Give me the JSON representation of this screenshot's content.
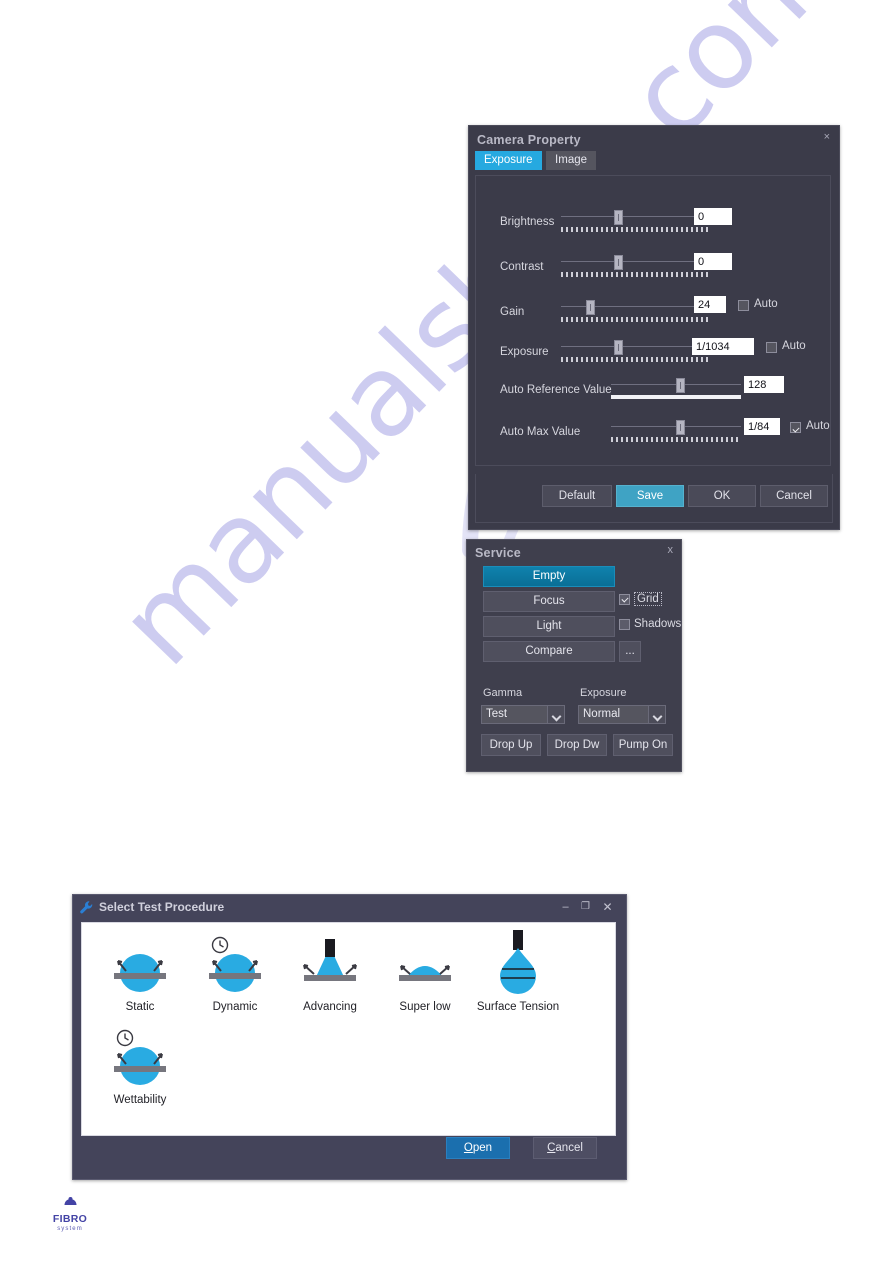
{
  "page": {
    "watermark": "manualshine.com"
  },
  "camera_property": {
    "title": "Camera Property",
    "close_label": "×",
    "tabs": [
      {
        "label": "Exposure",
        "active": true
      },
      {
        "label": "Image",
        "active": false
      }
    ],
    "rows": [
      {
        "label": "Brightness",
        "value": "0",
        "auto_label": null,
        "auto_checked": false,
        "thumb_pct": 36,
        "track_style": "dashed"
      },
      {
        "label": "Contrast",
        "value": "0",
        "auto_label": null,
        "auto_checked": false,
        "thumb_pct": 36,
        "track_style": "dashed"
      },
      {
        "label": "Gain",
        "value": "24",
        "auto_label": "Auto",
        "auto_checked": false,
        "thumb_pct": 17,
        "track_style": "dashed"
      },
      {
        "label": "Exposure",
        "value": "1/1034",
        "auto_label": "Auto",
        "auto_checked": false,
        "thumb_pct": 36,
        "track_style": "dashed"
      },
      {
        "label": "Auto Reference Value",
        "value": "128",
        "auto_label": null,
        "auto_checked": false,
        "thumb_pct": 50,
        "track_style": "solid"
      },
      {
        "label": "Auto Max Value",
        "value": "1/84",
        "auto_label": "Auto",
        "auto_checked": true,
        "thumb_pct": 50,
        "track_style": "dashed"
      }
    ],
    "buttons": [
      {
        "label": "Default",
        "accent": false
      },
      {
        "label": "Save",
        "accent": true
      },
      {
        "label": "OK",
        "accent": false
      },
      {
        "label": "Cancel",
        "accent": false
      }
    ]
  },
  "service": {
    "title": "Service",
    "close_label": "x",
    "buttons": [
      {
        "label": "Empty",
        "accent": true
      },
      {
        "label": "Focus",
        "accent": false
      },
      {
        "label": "Light",
        "accent": false
      },
      {
        "label": "Compare",
        "accent": false
      }
    ],
    "ellipsis_button": "...",
    "checkboxes": [
      {
        "label": "Grid",
        "checked": true,
        "focused": true
      },
      {
        "label": "Shadows",
        "checked": false,
        "focused": false
      }
    ],
    "selects": [
      {
        "group_label": "Gamma",
        "value": "Test"
      },
      {
        "group_label": "Exposure",
        "value": "Normal"
      }
    ],
    "action_buttons": [
      "Drop Up",
      "Drop Dw",
      "Pump On"
    ]
  },
  "select_test_procedure": {
    "title": "Select Test Procedure",
    "icon": "wrench-icon",
    "window_buttons": [
      {
        "name": "minimize",
        "glyph": "–"
      },
      {
        "name": "maximize",
        "glyph": "❐"
      },
      {
        "name": "close",
        "glyph": "✕"
      }
    ],
    "procedures": [
      {
        "label": "Static",
        "icon": "droplet-static-icon"
      },
      {
        "label": "Dynamic",
        "icon": "droplet-clock-icon"
      },
      {
        "label": "Advancing",
        "icon": "droplet-needle-icon"
      },
      {
        "label": "Super low",
        "icon": "droplet-flat-icon"
      },
      {
        "label": "Surface Tension",
        "icon": "pendant-drop-icon"
      },
      {
        "label": "Wettability",
        "icon": "droplet-clock-icon"
      }
    ],
    "footer_buttons": [
      {
        "label": "Open",
        "accel": "O",
        "primary": true
      },
      {
        "label": "Cancel",
        "accel": "C",
        "primary": false
      }
    ]
  },
  "fibro_logo": {
    "name": "FIBRO",
    "sub": "system"
  },
  "colors": {
    "dialog_bg": "#3b3b49",
    "accent_tab": "#26a9e0",
    "accent_save": "#3fa3c4",
    "accent_empty": "#0d7ca6",
    "accent_open": "#1b6fae",
    "droplet_blue": "#29abe2",
    "substrate_gray": "#7a7a82",
    "watermark": "#c9c8ef",
    "fibro_purple": "#4343a5"
  }
}
